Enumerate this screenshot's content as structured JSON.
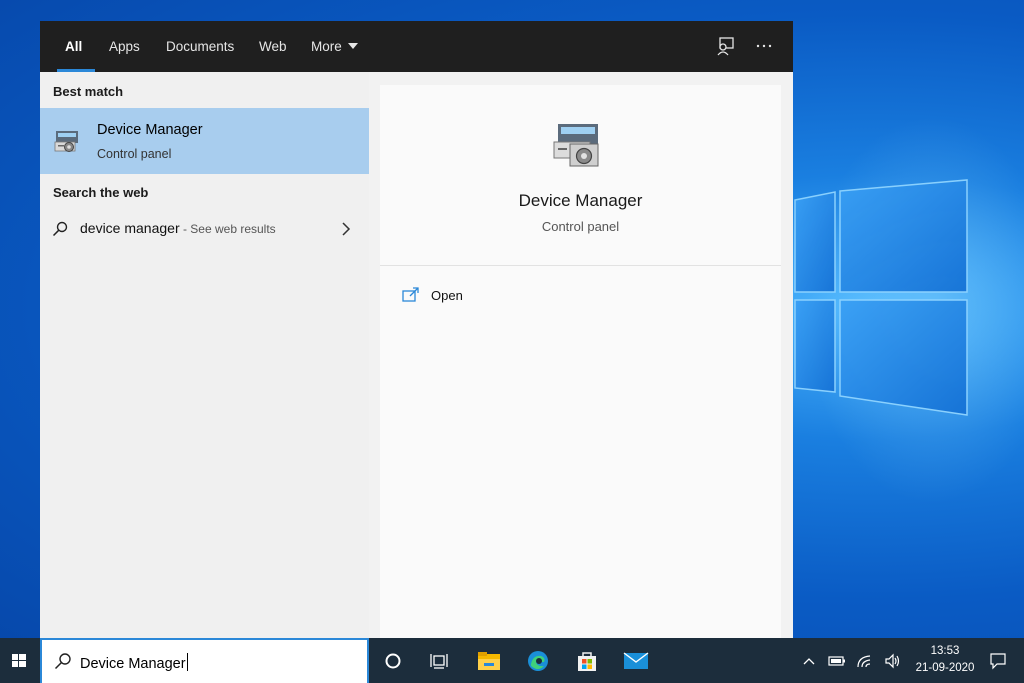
{
  "tabs": {
    "all": "All",
    "apps": "Apps",
    "documents": "Documents",
    "web": "Web",
    "more": "More"
  },
  "left": {
    "best_match_heading": "Best match",
    "best_match": {
      "title": "Device Manager",
      "subtitle": "Control panel"
    },
    "web_heading": "Search the web",
    "web_result": {
      "query": "device manager",
      "hint": " - See web results"
    }
  },
  "right": {
    "title": "Device Manager",
    "subtitle": "Control panel",
    "action_open": "Open"
  },
  "taskbar": {
    "search_value": "Device Manager",
    "time": "13:53",
    "date": "21-09-2020"
  },
  "colors": {
    "accent": "#2b88d8",
    "selection": "#a8cdee",
    "topbar": "#1f1f1f",
    "taskbar": "#1c2d3c"
  }
}
